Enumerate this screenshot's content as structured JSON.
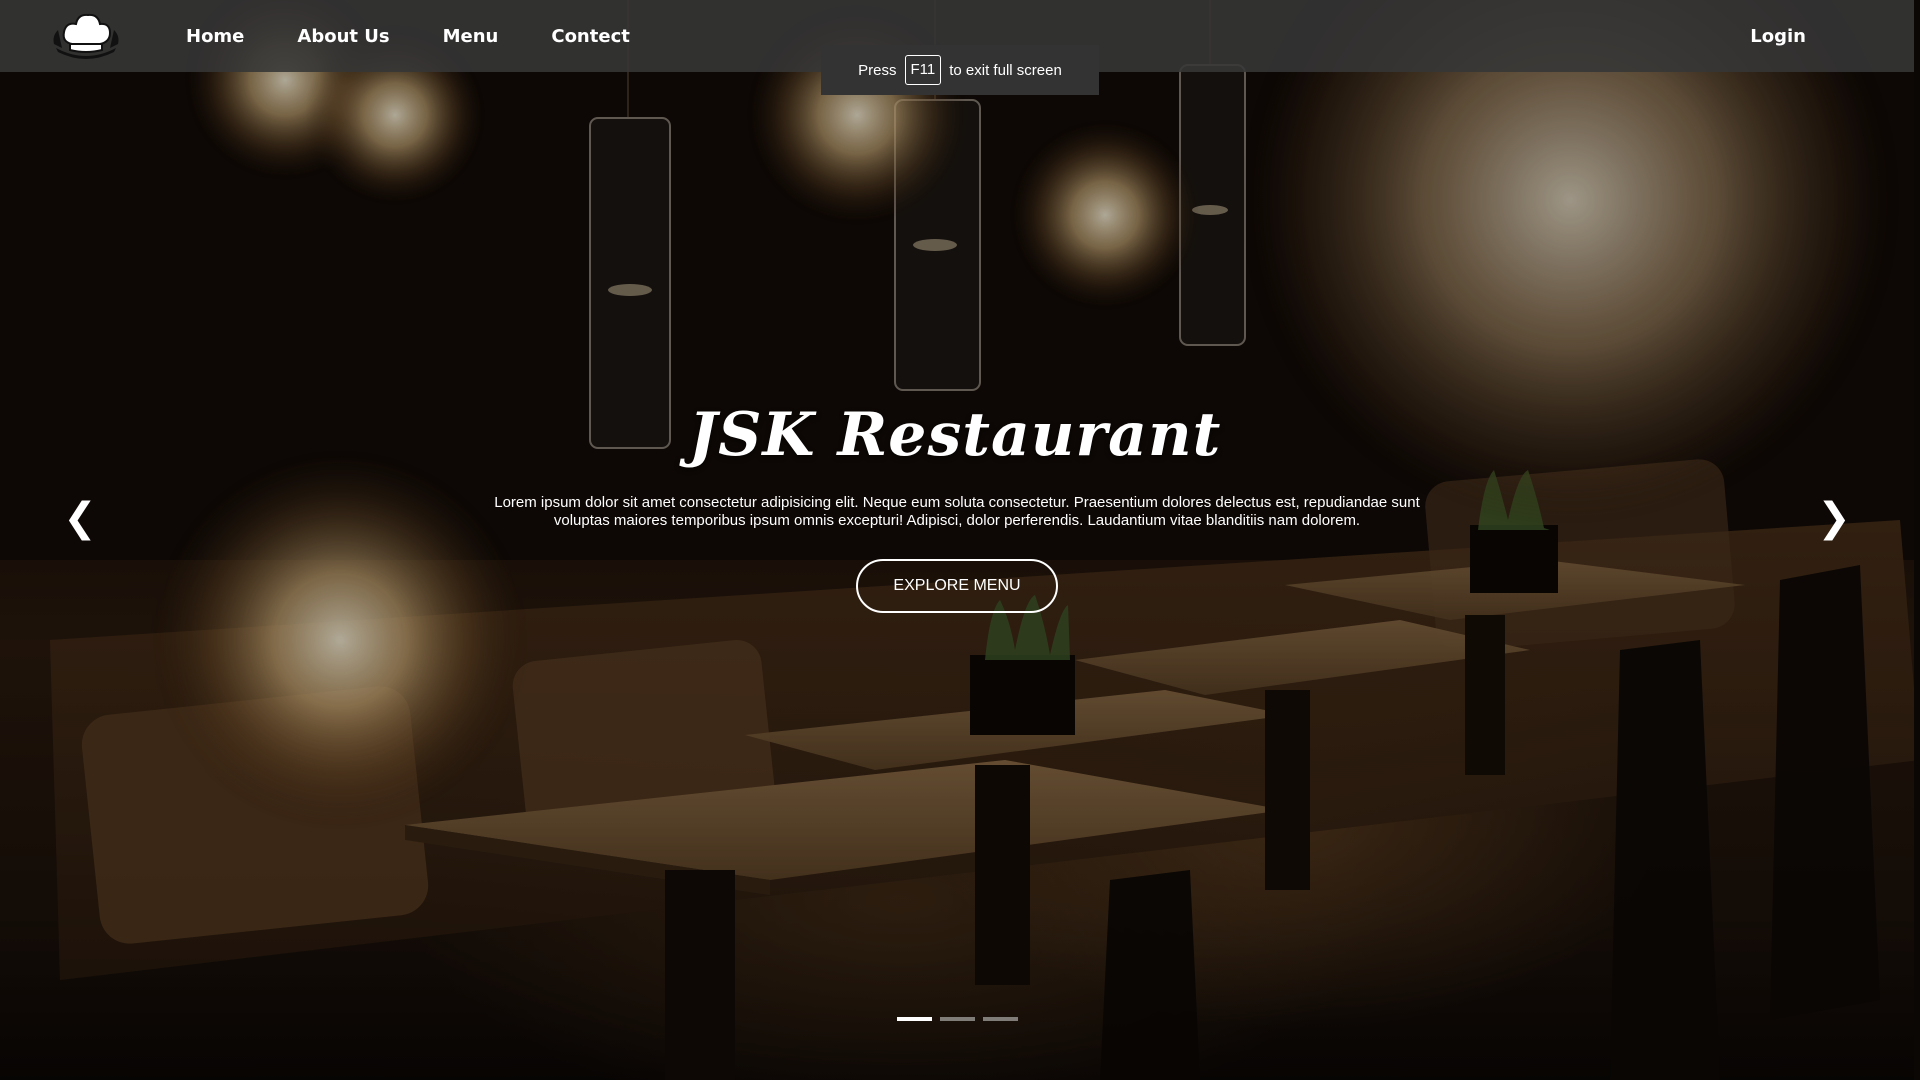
{
  "nav": {
    "logo_icon": "chef-hat-icon",
    "links": [
      "Home",
      "About Us",
      "Menu",
      "Contect"
    ],
    "login_label": "Login"
  },
  "fullscreen_notice": {
    "prefix": "Press",
    "key": "F11",
    "suffix": "to exit full screen"
  },
  "hero": {
    "title": "JSK Restaurant",
    "description": "Lorem ipsum dolor sit amet consectetur adipisicing elit. Neque eum soluta consectetur. Praesentium dolores delectus est, repudiandae sunt voluptas maiores temporibus ipsum omnis excepturi! Adipisci, dolor perferendis. Laudantium vitae blanditiis nam dolorem.",
    "cta_label": "EXPLORE MENU"
  },
  "carousel": {
    "prev_symbol": "❮",
    "next_symbol": "❯",
    "slide_count": 3,
    "active_index": 0
  },
  "colors": {
    "navbar_bg": "#373737",
    "text": "#ffffff",
    "toast_bg": "#333333"
  }
}
